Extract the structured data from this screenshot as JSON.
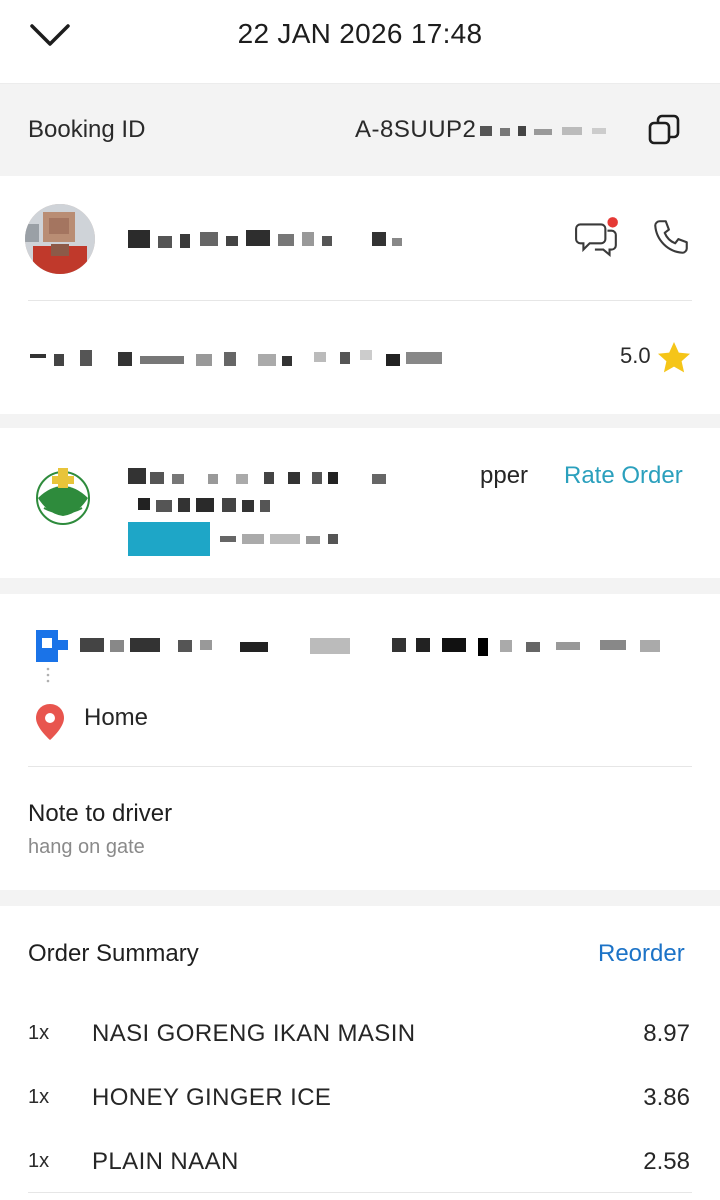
{
  "header": {
    "title": "22 JAN 2026 17:48",
    "back_icon": "chevron-down-icon"
  },
  "booking": {
    "label": "Booking ID",
    "value": "A-8SUUP2",
    "copy_icon": "copy-icon"
  },
  "driver": {
    "rating": "5.0",
    "chat_icon": "chat-icon",
    "call_icon": "phone-icon",
    "star_icon": "star-icon",
    "accent": "#f5c518",
    "unread_dot": "#e53935"
  },
  "merchant": {
    "merchant_partial_text": "pper",
    "rate_order_label": "Rate Order",
    "rate_color": "#2ba0bd"
  },
  "route": {
    "pickup_icon": "pickup-square-icon",
    "dropoff_icon": "location-pin-icon",
    "dropoff_label": "Home",
    "note_title": "Note to driver",
    "note_text": "hang on gate"
  },
  "order_summary": {
    "heading": "Order Summary",
    "reorder_label": "Reorder",
    "reorder_color": "#1c73c7",
    "items": [
      {
        "qty": "1x",
        "name": "NASI GORENG IKAN MASIN",
        "price": "8.97"
      },
      {
        "qty": "1x",
        "name": "HONEY GINGER ICE",
        "price": "3.86"
      },
      {
        "qty": "1x",
        "name": "PLAIN NAAN",
        "price": "2.58"
      }
    ]
  }
}
